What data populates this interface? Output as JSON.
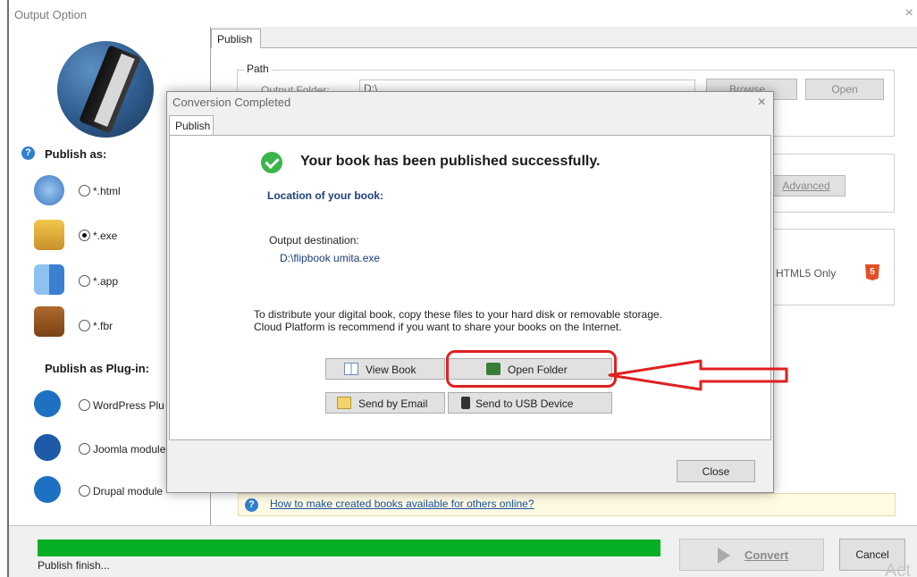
{
  "window": {
    "title": "Output Option",
    "close_glyph": "×"
  },
  "left_panel": {
    "publish_as_heading": "Publish as:",
    "publish_as_options": [
      {
        "label": "*.html",
        "icon": "globe-icon",
        "selected": false
      },
      {
        "label": "*.exe",
        "icon": "exe-lock-icon",
        "selected": true
      },
      {
        "label": "*.app",
        "icon": "mac-finder-icon",
        "selected": false
      },
      {
        "label": "*.fbr",
        "icon": "fbr-book-icon",
        "selected": false
      }
    ],
    "plugin_heading": "Publish as Plug-in:",
    "plugin_options": [
      {
        "label": "WordPress Plu",
        "icon": "wordpress-icon",
        "selected": false
      },
      {
        "label": "Joomla module",
        "icon": "joomla-icon",
        "selected": false
      },
      {
        "label": "Drupal module",
        "icon": "drupal-icon",
        "selected": false
      }
    ]
  },
  "publish_tab": {
    "tab_label": "Publish",
    "path_group_label": "Path",
    "output_folder_label": "Output Folder:",
    "output_folder_value": "D:\\",
    "browse_label": "Browse...",
    "open_label": "Open",
    "advanced_label": "Advanced",
    "html5_label": "HTML5 Only",
    "html5_icon": "html5-icon",
    "tip_link": "How to make created books available for others online?"
  },
  "bottom": {
    "status": "Publish finish...",
    "progress_percent": 100,
    "convert_label": "Convert",
    "cancel_label": "Cancel",
    "watermark_fragment": "Act"
  },
  "modal": {
    "title": "Conversion Completed",
    "close_glyph": "×",
    "tab_label": "Publish",
    "success_message": "Your book has been published successfully.",
    "location_heading": "Location of your book:",
    "destination_label": "Output destination:",
    "destination_value": "D:\\flipbook umita.exe",
    "info_line1": "To distribute your digital book, copy these files to your hard disk or removable storage.",
    "info_line2": "Cloud Platform is recommend if you want to share your books on the Internet.",
    "buttons": {
      "view_book": "View Book",
      "open_folder": "Open Folder",
      "send_email": "Send by Email",
      "send_usb": "Send to USB Device"
    },
    "close_label": "Close"
  },
  "colors": {
    "progress": "#06b025",
    "annotation": "#e02020",
    "link": "#1a4fa0"
  }
}
